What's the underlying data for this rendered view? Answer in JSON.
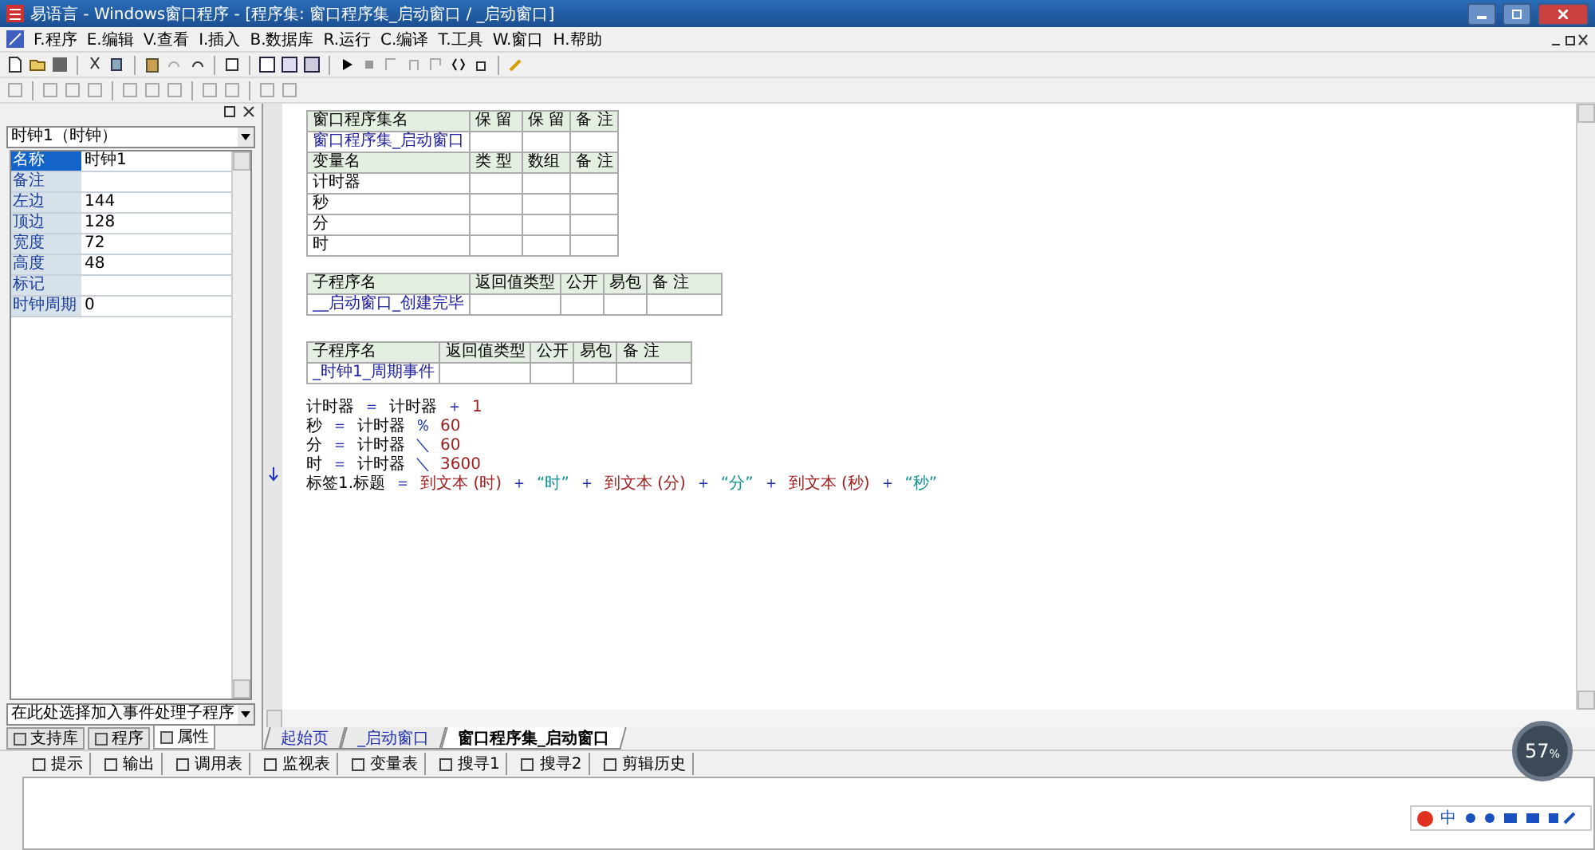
{
  "window": {
    "title": "易语言 - Windows窗口程序 - [程序集: 窗口程序集_启动窗口 / _启动窗口]"
  },
  "menu": [
    "F.程序",
    "E.编辑",
    "V.查看",
    "I.插入",
    "B.数据库",
    "R.运行",
    "C.编译",
    "T.工具",
    "W.窗口",
    "H.帮助"
  ],
  "properties": {
    "selector": "时钟1（时钟）",
    "rows": [
      {
        "name": "名称",
        "value": "时钟1",
        "selected": true
      },
      {
        "name": "备注",
        "value": "",
        "selected": false
      },
      {
        "name": "左边",
        "value": "144",
        "selected": false
      },
      {
        "name": "顶边",
        "value": "128",
        "selected": false
      },
      {
        "name": "宽度",
        "value": "72",
        "selected": false
      },
      {
        "name": "高度",
        "value": "48",
        "selected": false
      },
      {
        "name": "标记",
        "value": "",
        "selected": false
      },
      {
        "name": "时钟周期",
        "value": "0",
        "selected": false
      }
    ],
    "event_selector": "在此处选择加入事件处理子程序"
  },
  "left_tabs": [
    {
      "label": "支持库",
      "selected": false
    },
    {
      "label": "程序",
      "selected": false
    },
    {
      "label": "属性",
      "selected": true
    }
  ],
  "assembly": {
    "header": [
      "窗口程序集名",
      "保 留",
      "保 留",
      "备 注"
    ],
    "name": "窗口程序集_启动窗口",
    "var_header": [
      "变量名",
      "类 型",
      "数组",
      "备 注"
    ],
    "vars": [
      "计时器",
      "秒",
      "分",
      "时"
    ]
  },
  "subs": [
    {
      "header": [
        "子程序名",
        "返回值类型",
        "公开",
        "易包",
        "备 注"
      ],
      "name": "__启动窗口_创建完毕"
    },
    {
      "header": [
        "子程序名",
        "返回值类型",
        "公开",
        "易包",
        "备 注"
      ],
      "name": "_时钟1_周期事件",
      "code": [
        [
          {
            "kind": "var",
            "text": "计时器"
          },
          {
            "kind": "op",
            "text": "＝"
          },
          {
            "kind": "var",
            "text": "计时器"
          },
          {
            "kind": "op",
            "text": "＋"
          },
          {
            "kind": "num",
            "text": "1"
          }
        ],
        [
          {
            "kind": "var",
            "text": "秒"
          },
          {
            "kind": "op",
            "text": "＝"
          },
          {
            "kind": "var",
            "text": "计时器"
          },
          {
            "kind": "op",
            "text": "％"
          },
          {
            "kind": "num",
            "text": "60"
          }
        ],
        [
          {
            "kind": "var",
            "text": "分"
          },
          {
            "kind": "op",
            "text": "＝"
          },
          {
            "kind": "var",
            "text": "计时器"
          },
          {
            "kind": "op",
            "text": "＼"
          },
          {
            "kind": "num",
            "text": "60"
          }
        ],
        [
          {
            "kind": "var",
            "text": "时"
          },
          {
            "kind": "op",
            "text": "＝"
          },
          {
            "kind": "var",
            "text": "计时器"
          },
          {
            "kind": "op",
            "text": "＼"
          },
          {
            "kind": "num",
            "text": "3600"
          }
        ],
        [
          {
            "kind": "var",
            "text": "标签1.标题"
          },
          {
            "kind": "op",
            "text": "＝"
          },
          {
            "kind": "func",
            "text": "到文本 (时)"
          },
          {
            "kind": "op",
            "text": "＋"
          },
          {
            "kind": "str",
            "text": "“时”"
          },
          {
            "kind": "op",
            "text": "＋"
          },
          {
            "kind": "func",
            "text": "到文本 (分)"
          },
          {
            "kind": "op",
            "text": "＋"
          },
          {
            "kind": "str",
            "text": "“分”"
          },
          {
            "kind": "op",
            "text": "＋"
          },
          {
            "kind": "func",
            "text": "到文本 (秒)"
          },
          {
            "kind": "op",
            "text": "＋"
          },
          {
            "kind": "str",
            "text": "“秒”"
          }
        ]
      ]
    }
  ],
  "editor_tabs": [
    {
      "label": "起始页",
      "selected": false
    },
    {
      "label": "_启动窗口",
      "selected": false
    },
    {
      "label": "窗口程序集_启动窗口",
      "selected": true
    }
  ],
  "output_tabs": [
    "提示",
    "输出",
    "调用表",
    "监视表",
    "变量表",
    "搜寻1",
    "搜寻2",
    "剪辑历史"
  ],
  "speed_ball": {
    "value": "57",
    "unit": "%"
  },
  "ime": {
    "label": "中"
  }
}
